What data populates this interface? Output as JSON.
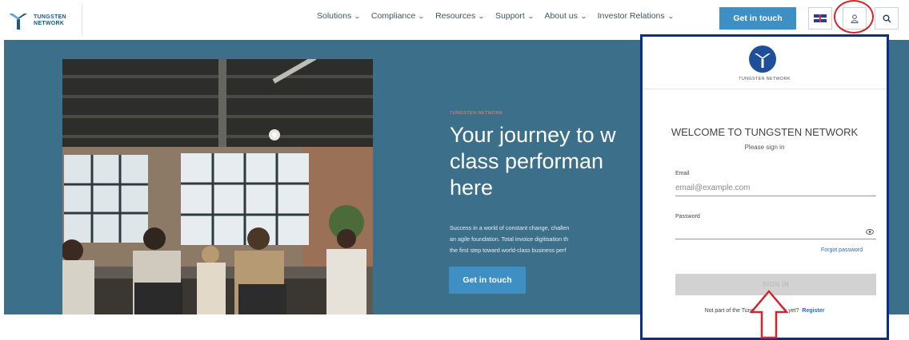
{
  "header": {
    "logo_line1": "TUNGSTEN",
    "logo_line2": "NETWORK",
    "nav": [
      {
        "label": "Solutions"
      },
      {
        "label": "Compliance"
      },
      {
        "label": "Resources"
      },
      {
        "label": "Support"
      },
      {
        "label": "About us"
      },
      {
        "label": "Investor Relations"
      }
    ],
    "cta_label": "Get in touch",
    "icons": {
      "language": "uk-flag-icon",
      "account": "user-icon",
      "search": "search-icon"
    }
  },
  "hero": {
    "eyebrow": "TUNGSTEN NETWORK",
    "title": "Your journey to w\nclass performan\nhere",
    "description": "Success in a world of constant change, challen\nan agile foundation. Total invoice digitisation th\nthe first step toward world-class business perf",
    "cta_label": "Get in touch"
  },
  "login": {
    "logo_text": "TUNGSTEN NETWORK",
    "title": "WELCOME TO TUNGSTEN NETWORK",
    "subtitle": "Please sign in",
    "email_label": "Email",
    "email_placeholder": "email@example.com",
    "password_label": "Password",
    "password_placeholder": "",
    "forgot_label": "Forgot password",
    "signin_label": "SIGN IN",
    "register_prompt": "Not part of the Tungsten Network yet?",
    "register_label": "Register"
  },
  "colors": {
    "accent": "#3d8fc4",
    "hero_bg": "#3c6f8a",
    "highlight": "#d6242b",
    "modal_border": "#0b2e8a"
  }
}
